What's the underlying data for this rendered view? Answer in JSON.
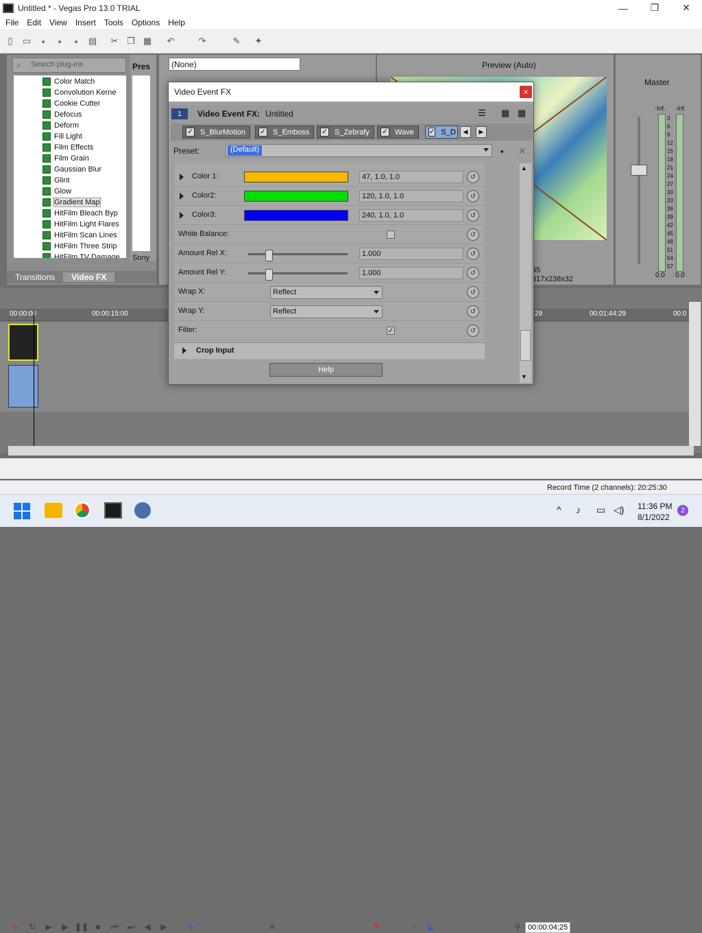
{
  "app": {
    "title": "Untitled * - Vegas Pro 13.0 TRIAL",
    "window_controls": [
      "—",
      "❐",
      "✕"
    ]
  },
  "menu": [
    "File",
    "Edit",
    "View",
    "Insert",
    "Tools",
    "Options",
    "Help"
  ],
  "plugins": {
    "search_placeholder": "Search plug-ins",
    "items": [
      "Color Match",
      "Convolution Kerne",
      "Cookie Cutter",
      "Defocus",
      "Deform",
      "Fill Light",
      "Film Effects",
      "Film Grain",
      "Gaussian Blur",
      "Glint",
      "Glow",
      "Gradient Map",
      "HitFilm Bleach Byp",
      "HitFilm Light Flares",
      "HitFilm Scan Lines",
      "HitFilm Three Strip",
      "HitFilm TV Damage"
    ],
    "selected": "Gradient Map",
    "presets_header": "Pres",
    "sony_label": "Sony",
    "tabs": [
      "Transitions",
      "Video FX"
    ]
  },
  "preset_none": "(None)",
  "preview": {
    "mode": "Preview (Auto)",
    "frame_info": "317x238x32",
    "frame_num": "45"
  },
  "master": {
    "title": "Master",
    "inf_left": "-Inf.",
    "inf_right": "-Inf.",
    "scale": [
      "3",
      "6",
      "9",
      "12",
      "15",
      "18",
      "21",
      "24",
      "27",
      "30",
      "33",
      "36",
      "39",
      "42",
      "45",
      "48",
      "51",
      "54",
      "57"
    ],
    "bottom_left": "0.0",
    "bottom_right": "0.0"
  },
  "timeline": {
    "cursor_time": "00:00:00",
    "markers": [
      "00:00:15:00",
      "29",
      "00:01:44:29",
      "00:0"
    ],
    "timecode": "00:00:04;25",
    "status": "Record Time (2 channels): 20:25:30"
  },
  "dialog": {
    "title": "Video Event FX",
    "close": "×",
    "track_num": "1",
    "header_label": "Video Event FX:",
    "header_value": "Untitled",
    "chain": [
      "S_BlurMotion",
      "S_Emboss",
      "S_Zebrafy",
      "Wave",
      "S_D"
    ],
    "preset_label": "Preset:",
    "preset_value": "(Default)",
    "params": {
      "color1": {
        "label": "Color 1:",
        "value": "47, 1.0, 1.0",
        "color": "#f6b800"
      },
      "color2": {
        "label": "Color2:",
        "value": "120, 1.0, 1.0",
        "color": "#00e000"
      },
      "color3": {
        "label": "Color3:",
        "value": "240, 1.0, 1.0",
        "color": "#0000ee"
      },
      "white_balance": {
        "label": "White Balance:",
        "checked": false
      },
      "amount_x": {
        "label": "Amount Rel X:",
        "value": "1.000",
        "fraction": 0.2
      },
      "amount_y": {
        "label": "Amount Rel Y:",
        "value": "1.000",
        "fraction": 0.2
      },
      "wrap_x": {
        "label": "Wrap X:",
        "value": "Reflect"
      },
      "wrap_y": {
        "label": "Wrap Y:",
        "value": "Reflect"
      },
      "filter": {
        "label": "Filter:",
        "checked": true
      }
    },
    "crop_input": "Crop Input",
    "help": "Help"
  },
  "taskbar": {
    "time": "11:36 PM",
    "date": "8/1/2022",
    "notifications": "2"
  }
}
